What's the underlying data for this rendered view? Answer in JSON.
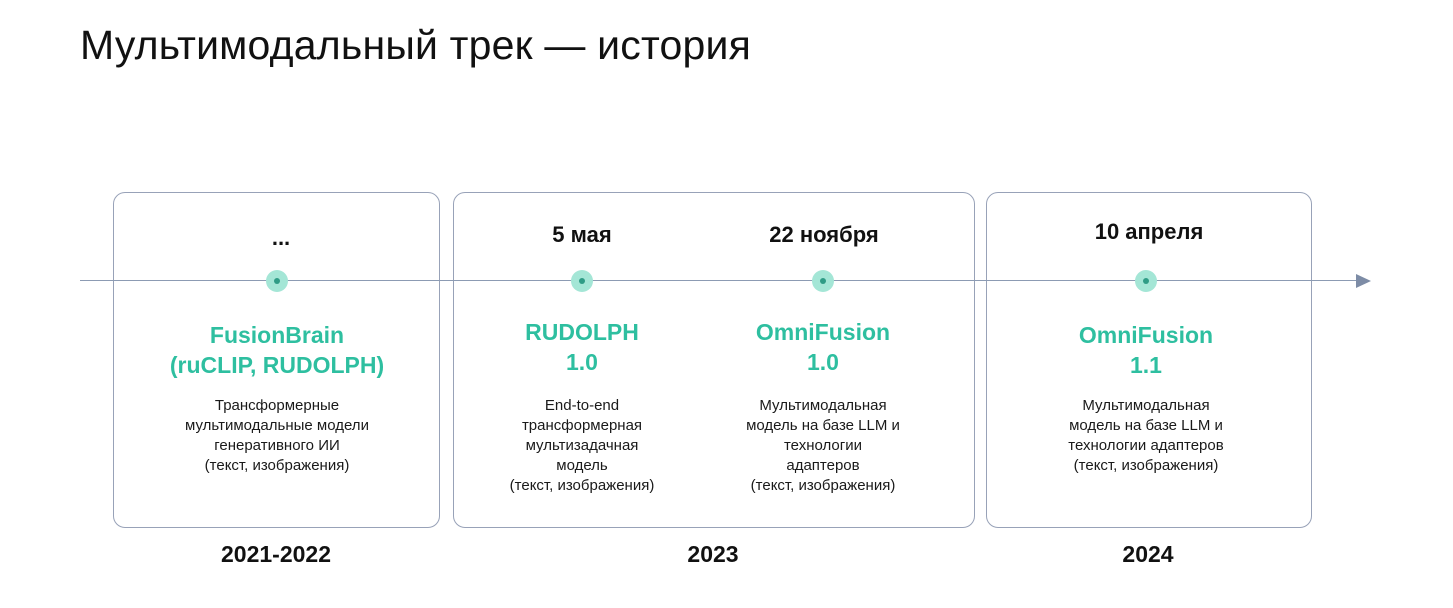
{
  "title": "Мультимодальный трек — история",
  "colors": {
    "accent": "#2ebfa0",
    "node_fill": "#a4e6d6",
    "node_center": "#2f9c86",
    "axis": "#8c9bb3",
    "box_border": "#98a2b8"
  },
  "milestones": [
    {
      "date": "...",
      "model_lines": [
        "FusionBrain",
        "(ruCLIP, RUDOLPH)"
      ],
      "desc_lines": [
        "Трансформерные",
        "мультимодальные модели",
        "генеративного ИИ",
        "(текст, изображения)"
      ]
    },
    {
      "date": "5 мая",
      "model_lines": [
        "RUDOLPH",
        "1.0"
      ],
      "desc_lines": [
        "End-to-end",
        "трансформерная",
        "мультизадачная",
        "модель",
        "(текст, изображения)"
      ]
    },
    {
      "date": "22 ноября",
      "model_lines": [
        "OmniFusion",
        "1.0"
      ],
      "desc_lines": [
        "Мультимодальная",
        "модель на базе LLM и",
        "технологии",
        "адаптеров",
        "(текст, изображения)"
      ]
    },
    {
      "date": "10 апреля",
      "model_lines": [
        "OmniFusion",
        "1.1"
      ],
      "desc_lines": [
        "Мультимодальная",
        "модель на базе LLM и",
        "технологии адаптеров",
        "(текст, изображения)"
      ]
    }
  ],
  "periods": [
    "2021-2022",
    "2023",
    "2024"
  ],
  "icons": {
    "timeline_arrow": "arrow-right-icon",
    "milestone_marker": "timeline-dot-icon"
  }
}
